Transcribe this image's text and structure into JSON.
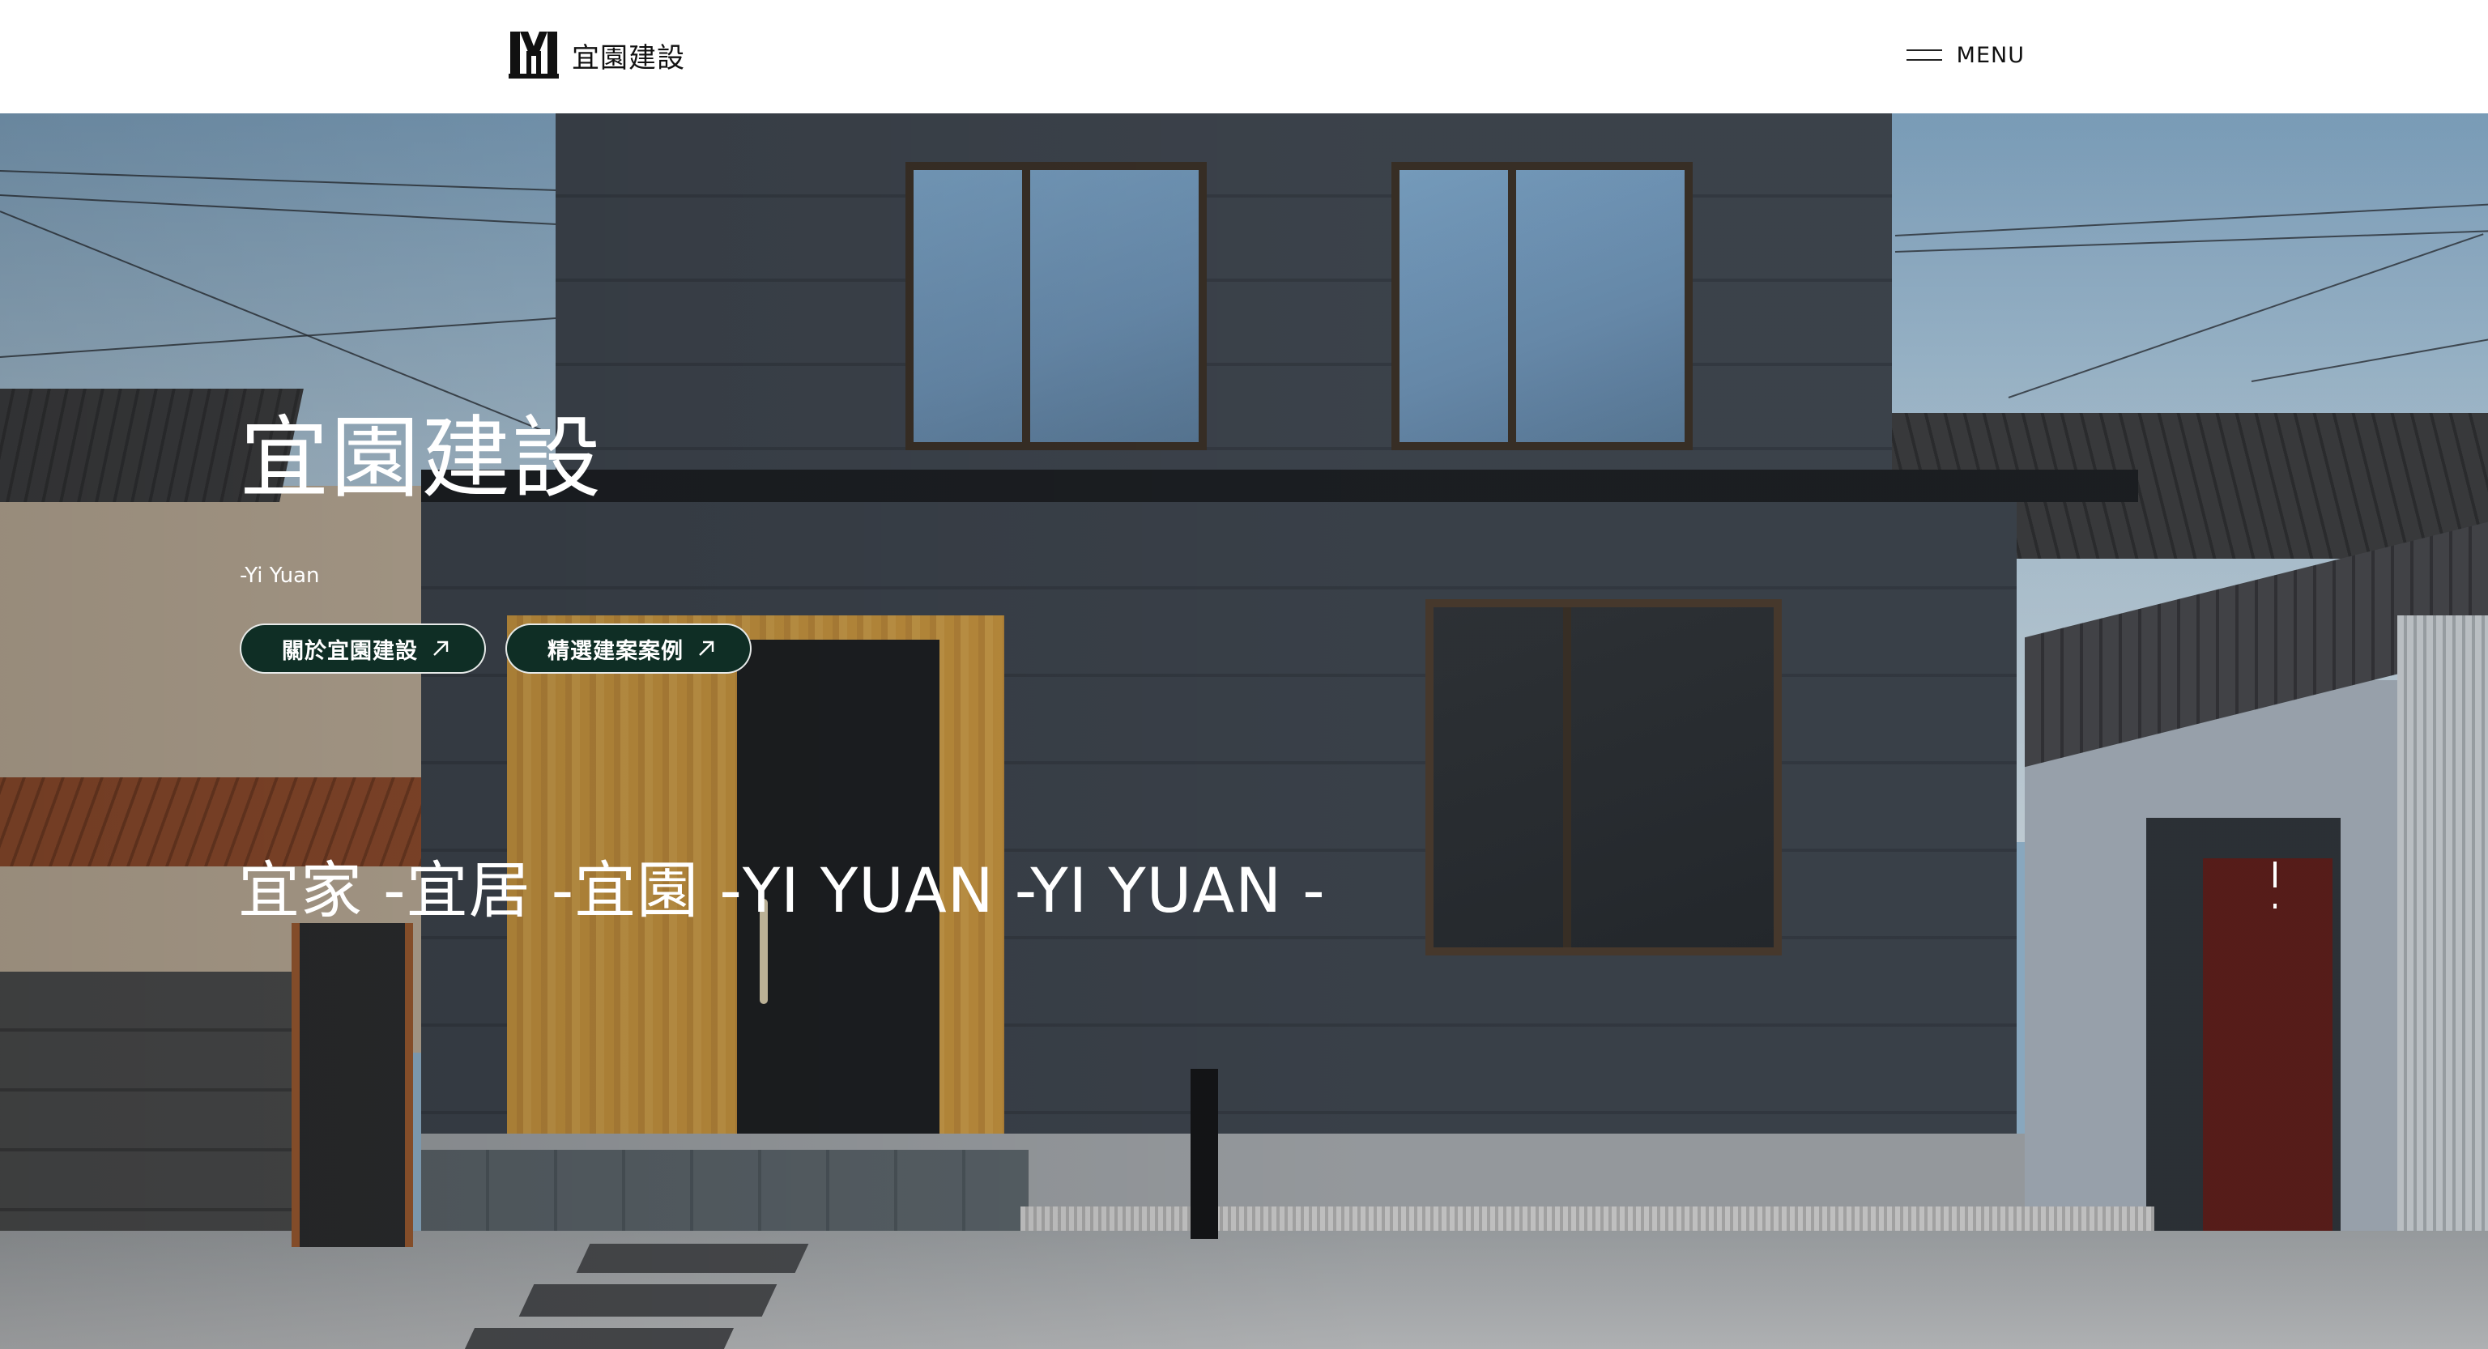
{
  "header": {
    "logo_text": "宜園建設",
    "menu_label": "MENU"
  },
  "hero": {
    "title": "宜園建設",
    "subtitle": "-Yi Yuan",
    "buttons": [
      {
        "label": "關於宜園建設",
        "icon": "arrow-up-right-icon"
      },
      {
        "label": "精選建案案例",
        "icon": "arrow-up-right-icon"
      }
    ],
    "marquee_text": "宜家 -宜居 -宜園 -YI YUAN -YI YUAN -"
  },
  "colors": {
    "button_bg": "#0f2e25",
    "header_bg": "#ffffff",
    "hero_text": "#ffffff"
  }
}
